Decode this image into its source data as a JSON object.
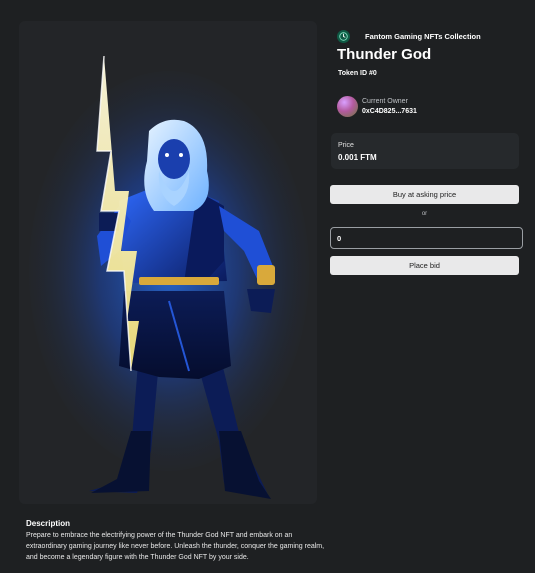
{
  "collection": {
    "name": "Fantom Gaming NFTs Collection",
    "logo_icon": "collection-logo-icon"
  },
  "nft": {
    "title": "Thunder God",
    "token_id": "Token ID #0",
    "image_icon": "thunder-god-artwork"
  },
  "owner": {
    "label": "Current Owner",
    "address": "0xC4D825...7631"
  },
  "price": {
    "label": "Price",
    "value": "0.001 FTM"
  },
  "actions": {
    "buy_label": "Buy at asking price",
    "or_label": "or",
    "bid_value": "0",
    "bid_label": "Place bid"
  },
  "description": {
    "title": "Description",
    "text": "Prepare to embrace the electrifying power of the Thunder God NFT and embark on an extraordinary gaming journey like never before. Unleash the thunder, conquer the gaming realm, and become a legendary figure with the Thunder God NFT by your side."
  },
  "colors": {
    "background": "#1e2022",
    "card": "#26292c",
    "button": "#e9e9ea",
    "glow": "#1e6bff"
  }
}
